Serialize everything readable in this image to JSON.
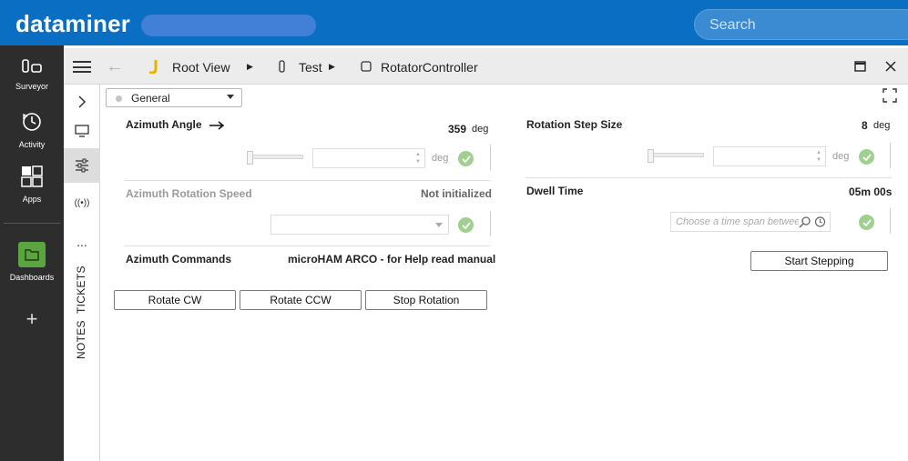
{
  "header": {
    "brand": "dataminer",
    "search_placeholder": "Search"
  },
  "sidebar": {
    "items": [
      {
        "label": "Surveyor",
        "icon": "surveyor-icon"
      },
      {
        "label": "Activity",
        "icon": "activity-icon"
      },
      {
        "label": "Apps",
        "icon": "apps-icon"
      },
      {
        "label": "Dashboards",
        "icon": "dashboards-icon"
      }
    ],
    "add_icon": "plus-icon"
  },
  "toolbar": {
    "breadcrumbs": [
      "Root View",
      "Test",
      "RotatorController"
    ]
  },
  "subsidebar": {
    "tickets": "TICKETS",
    "notes": "NOTES",
    "more": "..."
  },
  "content": {
    "page_selector": "General",
    "azimuth_angle": {
      "label": "Azimuth Angle",
      "value": "359",
      "unit": "deg",
      "input_unit": "deg"
    },
    "azimuth_speed": {
      "label": "Azimuth Rotation Speed",
      "value": "Not initialized"
    },
    "azimuth_commands": {
      "label": "Azimuth Commands",
      "value": "microHAM ARCO - for Help read manual"
    },
    "buttons": [
      "Rotate CW",
      "Rotate CCW",
      "Stop Rotation"
    ],
    "step_size": {
      "label": "Rotation Step Size",
      "value": "8",
      "unit": "deg",
      "input_unit": "deg"
    },
    "dwell_time": {
      "label": "Dwell Time",
      "value": "05m 00s",
      "placeholder": "Choose a time span between"
    },
    "start_button": "Start Stepping"
  },
  "colors": {
    "header_bg": "#0a6fc2",
    "sidebar_bg": "#2d2d2d",
    "dashboards_accent": "#5aa540",
    "check_green": "#9fd08f"
  }
}
